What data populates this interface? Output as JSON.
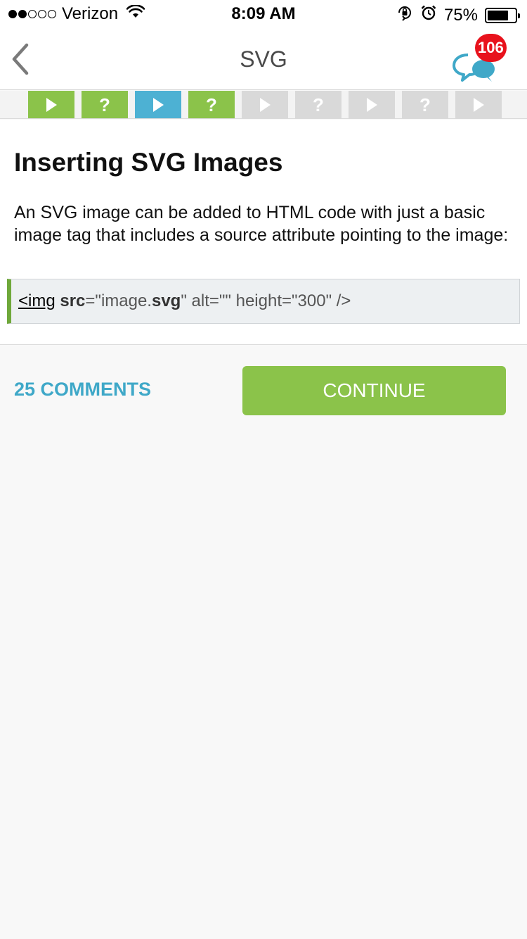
{
  "status_bar": {
    "carrier": "Verizon",
    "time": "8:09 AM",
    "battery_percent": "75%",
    "battery_level": 0.75,
    "signal_bars_filled": 2,
    "signal_bars_total": 5
  },
  "nav": {
    "title": "SVG",
    "notification_count": "106",
    "back_icon": "chevron-left-icon",
    "chat_icon": "chat-bubbles-icon"
  },
  "progress": {
    "steps": [
      {
        "kind": "play",
        "state": "done"
      },
      {
        "kind": "quiz",
        "state": "done"
      },
      {
        "kind": "play",
        "state": "current"
      },
      {
        "kind": "quiz",
        "state": "done"
      },
      {
        "kind": "play",
        "state": "locked"
      },
      {
        "kind": "quiz",
        "state": "locked"
      },
      {
        "kind": "play",
        "state": "locked"
      },
      {
        "kind": "quiz",
        "state": "locked"
      },
      {
        "kind": "play",
        "state": "locked"
      }
    ],
    "quiz_glyph": "?",
    "colors": {
      "done": "#8bc34a",
      "current": "#4db1d3",
      "locked": "#d9d9d9"
    }
  },
  "lesson": {
    "title": "Inserting SVG Images",
    "body": "An SVG image can be added to HTML code with just a basic image tag that includes a source attribute pointing to the image:",
    "code": {
      "tag": "<img",
      "attr1_name": "src",
      "attr1_eq": "=\"image.",
      "attr1_ext": "svg",
      "rest": "\" alt=\"\" height=\"300\" />"
    }
  },
  "footer": {
    "comments_label": "25 COMMENTS",
    "continue_label": "CONTINUE"
  },
  "colors": {
    "accent_green": "#8bc34a",
    "accent_blue": "#3fa8c8",
    "badge_red": "#e8121c"
  }
}
